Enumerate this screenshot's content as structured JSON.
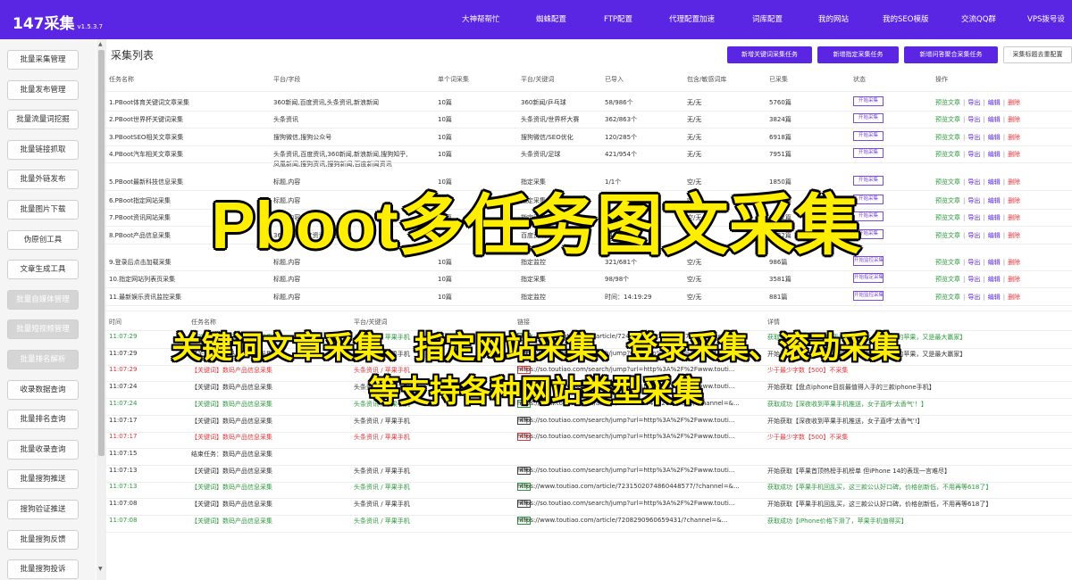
{
  "app": {
    "title": "147采集",
    "version": "v1.5.3.7"
  },
  "nav": [
    "大神帮帮忙",
    "蜘蛛配置",
    "FTP配置",
    "代理配置加速",
    "词库配置",
    "我的网站",
    "我的SEO模版",
    "交流QQ群",
    "VPS拨号设"
  ],
  "sidebar": [
    {
      "label": "批量采集管理",
      "disabled": false
    },
    {
      "label": "批量发布管理",
      "disabled": false
    },
    {
      "label": "批量流量词挖掘",
      "disabled": false
    },
    {
      "label": "批量链接抓取",
      "disabled": false
    },
    {
      "label": "批量外链发布",
      "disabled": false
    },
    {
      "label": "批量图片下载",
      "disabled": false
    },
    {
      "label": "伪原创工具",
      "disabled": false
    },
    {
      "label": "文章生成工具",
      "disabled": false
    },
    {
      "label": "批量自媒体管理",
      "disabled": true
    },
    {
      "label": "批量短视频管理",
      "disabled": true
    },
    {
      "label": "批量排名解析",
      "disabled": true
    },
    {
      "label": "收录数据查询",
      "disabled": false
    },
    {
      "label": "批量排名查询",
      "disabled": false
    },
    {
      "label": "批量收录查询",
      "disabled": false
    },
    {
      "label": "批量搜狗推送",
      "disabled": false
    },
    {
      "label": "搜狗验证推送",
      "disabled": false
    },
    {
      "label": "批量搜狗反馈",
      "disabled": false
    },
    {
      "label": "批量搜狗投诉",
      "disabled": false
    }
  ],
  "main": {
    "title": "采集列表",
    "toolbar": [
      "新增关键词采集任务",
      "新增指定采集任务",
      "新增问答聚合采集任务",
      "采集标题去重配置"
    ],
    "columns": [
      "任务名称",
      "平台/字段",
      "单个词采集",
      "平台/关键词",
      "已导入",
      "包含/敏感词库",
      "已采集",
      "状态",
      "操作"
    ],
    "ops": {
      "preview": "预览文章",
      "export": "导出",
      "edit": "编辑",
      "del": "删除",
      "sep": "|"
    },
    "tasks": [
      {
        "name": "1.PBoot体育关键词文章采集",
        "fields": "360新闻,百度资讯,头条资讯,新浪新闻",
        "per": "10篇",
        "kw": "360新闻/乒乓球",
        "imported": "58/986个",
        "dict": "无/无",
        "collected": "5760篇",
        "status": "开始采集"
      },
      {
        "name": "2.PBoot世界杯关键词采集",
        "fields": "头条资讯",
        "per": "10篇",
        "kw": "头条资讯/世界杯大赛",
        "imported": "362/863个",
        "dict": "无/无",
        "collected": "3824篇",
        "status": "开始采集"
      },
      {
        "name": "3.PBootSEO相关文章采集",
        "fields": "搜狗微信,搜狗公众号",
        "per": "10篇",
        "kw": "搜狗微信/SEO优化",
        "imported": "120/285个",
        "dict": "无/无",
        "collected": "6918篇",
        "status": "开始采集"
      },
      {
        "name": "4.PBoot汽车相关文章采集",
        "fields": "头条资讯,百度资讯,360新闻,新浪新闻,搜狗知乎,",
        "fields2": "凤凰新闻,搜狗资讯,搜狗新闻,百度新闻资讯",
        "per": "10篇",
        "kw": "头条资讯/足球",
        "imported": "421/954个",
        "dict": "无/无",
        "collected": "7951篇",
        "status": "开始采集"
      },
      {
        "name": "5.PBoot最新科技信息采集",
        "fields": "标题,内容",
        "per": "10篇",
        "kw": "指定采集",
        "imported": "1/1个",
        "dict": "空/无",
        "collected": "1850篇",
        "status": "开始采集"
      },
      {
        "name": "6.PBoot指定网站采集",
        "fields": "标题,内容",
        "per": "10篇",
        "kw": "指定采集",
        "imported": "1/1个",
        "dict": "空/无",
        "collected": "2341篇",
        "status": "开始采集"
      },
      {
        "name": "7.PBoot资讯网站采集",
        "fields": "标题,内容",
        "per": "10篇",
        "kw": "指定采集",
        "imported": "1/1个",
        "dict": "空/无",
        "collected": "1952篇",
        "status": "开始采集"
      },
      {
        "name": "8.PBoot产品信息采集",
        "fields": "360新闻,百度资讯,百度新闻",
        "per": "10篇",
        "kw": "百度资讯",
        "imported": "54/98个",
        "dict": "空/无",
        "collected": "1732篇",
        "status": "开始采集"
      },
      {
        "name": "9.登录后点击加载采集",
        "fields": "标题,内容",
        "per": "10篇",
        "kw": "指定监控",
        "imported": "321/681个",
        "dict": "空/无",
        "collected": "986篇",
        "status": "开始监控采集"
      },
      {
        "name": "10.指定网站列表页采集",
        "fields": "标题,内容",
        "per": "10篇",
        "kw": "指定采集",
        "imported": "98/98个",
        "dict": "空/无",
        "collected": "3581篇",
        "status": "开始指定采集"
      },
      {
        "name": "11.最新娱乐资讯监控采集",
        "fields": "标题,内容",
        "per": "10篇",
        "kw": "指定监控",
        "imported": "时间：14:19:29",
        "dict": "空/无",
        "collected": "881篇",
        "status": "开始监控采集"
      }
    ],
    "log_columns": [
      "时间",
      "任务名称",
      "平台/关键词",
      "链接",
      "详情"
    ],
    "logs": [
      {
        "time": "11:07:29",
        "task": "【关键词】数码产品信息采集",
        "plat": "头条资讯 / 苹果手机",
        "tag": "采集",
        "url": "https://www.toutiao.com/article/7245062749326180879/?channel=&...",
        "detail": "获取成功【2023年618手机大战收官 不知道买的苹果，又是最大赢家】",
        "color": "green"
      },
      {
        "time": "11:07:29",
        "task": "【关键词】数码产品信息采集",
        "plat": "头条资讯 / 苹果手机",
        "tag": "采集",
        "url": "https://so.toutiao.com/search/jump?url=http%3A%2F%2Fwww.touti...",
        "detail": "开始获取【2023年618手机大战收官 不知道买的苹果，又是最大赢家】",
        "color": "black"
      },
      {
        "time": "11:07:29",
        "task": "【关键词】数码产品信息采集",
        "plat": "头条资讯 / 苹果手机",
        "tag": "采集",
        "url": "https://so.toutiao.com/search/jump?url=http%3A%2F%2Fwww.touti...",
        "detail": "少于最少字数【500】不采集",
        "color": "red"
      },
      {
        "time": "11:07:24",
        "task": "【关键词】数码产品信息采集",
        "plat": "头条资讯 / 苹果手机",
        "tag": "采集",
        "url": "https://so.toutiao.com/search/jump?url=http%3A%2F%2Fwww.touti...",
        "detail": "开始获取【盘点iphone目前最值得入手的三款iphone手机】",
        "color": "black"
      },
      {
        "time": "11:07:24",
        "task": "【关键词】数码产品信息采集",
        "plat": "头条资讯 / 苹果手机",
        "tag": "采集",
        "url": "https://www.toutiao.com/article/7245062749326180879/?channel=&...",
        "detail": "获取成功【深夜收到苹果手机推送，女子直呼'太香气'！】",
        "color": "green"
      },
      {
        "time": "11:07:17",
        "task": "【关键词】数码产品信息采集",
        "plat": "头条资讯 / 苹果手机",
        "tag": "采集",
        "url": "https://so.toutiao.com/search/jump?url=http%3A%2F%2Fwww.touti...",
        "detail": "开始获取【深夜收到苹果手机推送，女子直呼'太香气'!】",
        "color": "black"
      },
      {
        "time": "11:07:17",
        "task": "【关键词】数码产品信息采集",
        "plat": "头条资讯 / 苹果手机",
        "tag": "采集",
        "url": "https://so.toutiao.com/search/jump?url=http%3A%2F%2Fwww.touti...",
        "detail": "少于最少字数【500】不采集",
        "color": "red"
      },
      {
        "time": "11:07:15",
        "task": "结束任务：数码产品信息采集",
        "plat": "",
        "tag": "",
        "url": "",
        "detail": "",
        "color": "black"
      },
      {
        "time": "11:07:13",
        "task": "【关键词】数码产品信息采集",
        "plat": "头条资讯 / 苹果手机",
        "tag": "采集",
        "url": "https://so.toutiao.com/search/jump?url=http%3A%2F%2Fwww.touti...",
        "detail": "开始获取【苹果首顶热榜手机榜单 但iPhone 14的表现一言难尽】",
        "color": "black"
      },
      {
        "time": "11:07:13",
        "task": "【关键词】数码产品信息采集",
        "plat": "头条资讯 / 苹果手机",
        "tag": "采集",
        "url": "https://www.toutiao.com/article/7231502074860448577/?channel=&...",
        "detail": "获取成功【苹果手机回乱买，这三款公认好口碑，价格创新低，不用再等618了】",
        "color": "green"
      },
      {
        "time": "11:07:08",
        "task": "【关键词】数码产品信息采集",
        "plat": "头条资讯 / 苹果手机",
        "tag": "采集",
        "url": "https://so.toutiao.com/search/jump?url=http%3A%2F%2Fwww.touti...",
        "detail": "开始获取【苹果手机回乱买，这三款公认好口碑，价格创新低，不用再等618了】",
        "color": "black"
      },
      {
        "time": "11:07:08",
        "task": "【关键词】数码产品信息采集",
        "plat": "头条资讯 / 苹果手机",
        "tag": "采集",
        "url": "https://www.toutiao.com/article/7208290960659431/?channel=&...",
        "detail": "获取成功【iPhone价格下滑了，苹果手机值得买】",
        "color": "green"
      }
    ]
  },
  "overlay": {
    "title": "Pboot多任务图文采集",
    "sub1": "关键词文章采集、指定网站采集、登录采集、滚动采集",
    "sub2": "等支持各种网站类型采集"
  },
  "colors": {
    "accent": "#5b26e3",
    "green": "#2b9a3c",
    "red": "#e0363d",
    "overlay": "#ffee00"
  }
}
